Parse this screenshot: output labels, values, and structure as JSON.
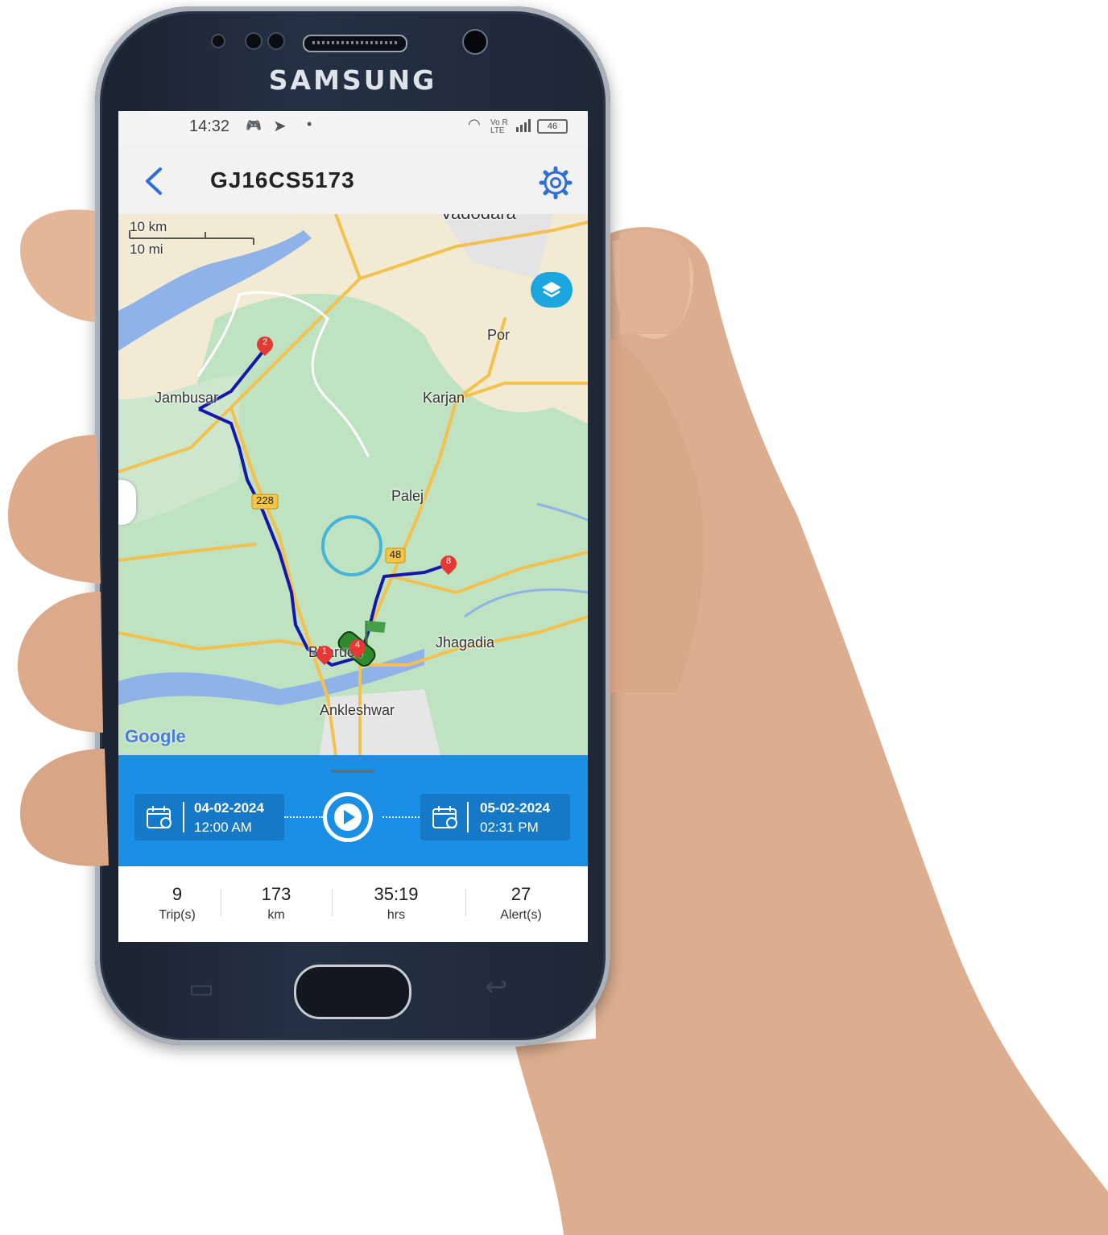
{
  "device": {
    "brand": "SAMSUNG"
  },
  "status_bar": {
    "time": "14:32",
    "network": "Vo R LTE",
    "battery": "46"
  },
  "header": {
    "title": "GJ16CS5173",
    "back_icon": "chevron-left-icon",
    "settings_icon": "gear-icon"
  },
  "map": {
    "scale_km": "10 km",
    "scale_mi": "10 mi",
    "places": [
      "Vadodara",
      "Por",
      "Jambusar",
      "Karjan",
      "Palej",
      "Jhagadia",
      "Bharuch",
      "Ankleshwar"
    ],
    "road_shields": [
      "228",
      "48"
    ],
    "markers": [
      "1",
      "2",
      "4",
      "8"
    ],
    "attribution": "Google",
    "layers_icon": "layers-icon"
  },
  "playback": {
    "start_date": "04-02-2024",
    "start_time": "12:00 AM",
    "end_date": "05-02-2024",
    "end_time": "02:31 PM",
    "play_icon": "play-icon",
    "calendar_icon": "calendar-icon"
  },
  "stats": [
    {
      "value": "9",
      "label": "Trip(s)"
    },
    {
      "value": "173",
      "label": "km"
    },
    {
      "value": "35:19",
      "label": "hrs"
    },
    {
      "value": "27",
      "label": "Alert(s)"
    }
  ],
  "colors": {
    "accent": "#1b8fe6",
    "route": "#1515b0",
    "marker": "#e53935"
  }
}
